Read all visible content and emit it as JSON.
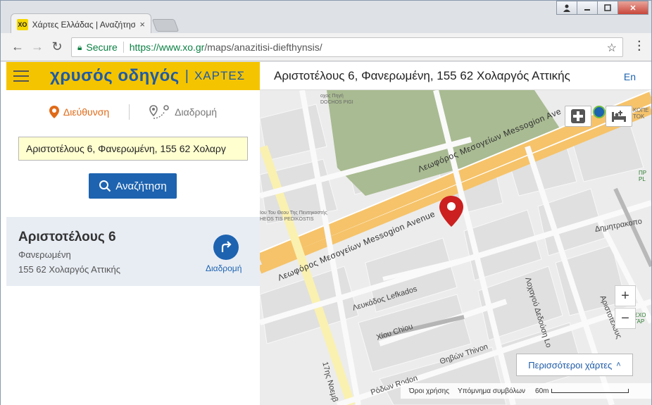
{
  "browser": {
    "tab_favicon": "XO",
    "tab_title": "Χάρτες Ελλάδας | Αναζήτηση",
    "tab_close": "×",
    "window_controls": [
      "user-icon",
      "minimize-icon",
      "maximize-icon",
      "close-icon"
    ],
    "secure_label": "Secure",
    "url_scheme_host": "https://www.xo.gr",
    "url_path": "/maps/anazitisi-diefthynsis/"
  },
  "sidebar": {
    "brand_name": "χρυσός οδηγός",
    "brand_sep": "|",
    "brand_sub": "ΧΑΡΤΕΣ",
    "mode_address": "Διεύθυνση",
    "mode_route": "Διαδρομή",
    "address_value": "Αριστοτέλους 6, Φανερωμένη, 155 62 Χολαργ",
    "search_label": "Αναζήτηση",
    "result": {
      "title": "Αριστοτέλους 6",
      "line1": "Φανερωμένη",
      "line2": "155 62 Χολαργός Αττικής",
      "route_label": "Διαδρομή"
    }
  },
  "map": {
    "header_address": "Αριστοτέλους 6, Φανερωμένη, 155 62 Χολαργός Αττικής",
    "lang": "En",
    "labels": {
      "avenue_el": "Λεωφόρος Μεσογείων",
      "avenue_el_top": "Λεωφόρος Μεσογείων Messogion Ave",
      "avenue_en": "Λεωφόρος Μεσογείων Messogion Avenue",
      "lefkados": "Λευκάδος Lefkados",
      "chiou": "Χίου Chiou",
      "thivon": "Θηβών Thivon",
      "rodon": "Ρόδων Rodon",
      "lochagou": "Λοχαγού Δεδούση Lo",
      "dimitrakopoulou": "Δημητρακοπο",
      "aristotelous": "Αριστοτέλους",
      "noem": "17ης Νοεμβ",
      "poi_church_el": "Ιου Του Θεου Της Πεντηκοστής",
      "poi_church_en": "HEOS TIS PEDIKOSTIS",
      "poi_pigi_el": "οχος Πηγή",
      "poi_pigi_en": "DOCHOS PIGI",
      "poi_right1": "ΚΟΠΕ",
      "poi_right2": "ΤΟΚ",
      "poi_green1": "ΠΡ",
      "poi_green2": "PL",
      "poi_green3": "ΣΧΟ",
      "poi_green4": "ΓΑΡ"
    },
    "zoom_in": "+",
    "zoom_out": "−",
    "more_maps": "Περισσότεροι χάρτες",
    "more_maps_caret": "˄",
    "footer_terms": "Όροι χρήσης",
    "footer_legend": "Υπόμνημα συμβόλων",
    "footer_scale": "60m"
  }
}
